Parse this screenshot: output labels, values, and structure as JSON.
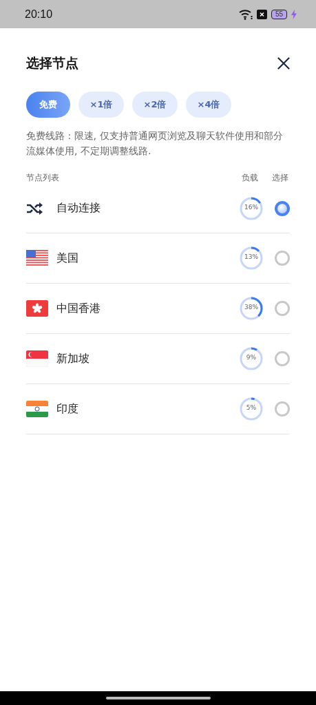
{
  "status_bar": {
    "time": "20:10",
    "battery": "55"
  },
  "dialog": {
    "title": "选择节点"
  },
  "tabs": [
    {
      "label": "免费",
      "selected": true
    },
    {
      "label": "×1倍",
      "selected": false
    },
    {
      "label": "×2倍",
      "selected": false
    },
    {
      "label": "×4倍",
      "selected": false
    }
  ],
  "description": "免费线路 : 限速, 仅支持普通网页浏览及聊天软件使用和部分流媒体使用, 不定期调整线路.",
  "list": {
    "heading": "节点列表",
    "load_heading": "负载",
    "select_heading": "选择",
    "nodes": [
      {
        "kind": "auto",
        "name": "自动连接",
        "level": 0.16,
        "load": "16%",
        "selected": true
      },
      {
        "kind": "us",
        "name": "美国",
        "level": 0.13,
        "load": "13%",
        "selected": false
      },
      {
        "kind": "hk",
        "name": "中国香港",
        "level": 0.38,
        "load": "38%",
        "selected": false
      },
      {
        "kind": "sg",
        "name": "新加坡",
        "level": 0.09,
        "load": "9%",
        "selected": false
      },
      {
        "kind": "in",
        "name": "印度",
        "level": 0.05,
        "load": "5%",
        "selected": false
      }
    ]
  }
}
